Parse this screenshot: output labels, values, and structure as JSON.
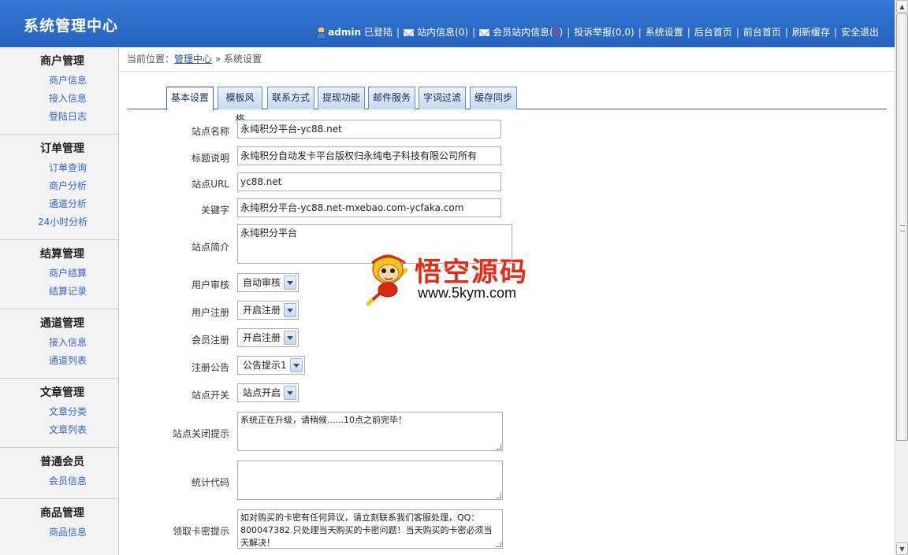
{
  "header": {
    "title": "系统管理中心",
    "user": "admin",
    "logged_in": "已登陆",
    "links": {
      "site_msg": "站内信息",
      "site_msg_count": "(0)",
      "member_msg": "会员站内信息",
      "member_msg_open": "(",
      "member_msg_count": "0",
      "member_msg_close": ")",
      "complaint": "投诉举报(0,0)",
      "settings": "系统设置",
      "admin_home": "后台首页",
      "front_home": "前台首页",
      "refresh_cache": "刷新缓存",
      "logout": "安全退出"
    }
  },
  "sidebar": {
    "groups": [
      {
        "title": "商户管理",
        "items": [
          "商户信息",
          "接入信息",
          "登陆日志"
        ]
      },
      {
        "title": "订单管理",
        "items": [
          "订单查询",
          "商户分析",
          "通道分析",
          "24小时分析"
        ]
      },
      {
        "title": "结算管理",
        "items": [
          "商户结算",
          "结算记录"
        ]
      },
      {
        "title": "通道管理",
        "items": [
          "接入信息",
          "通道列表"
        ]
      },
      {
        "title": "文章管理",
        "items": [
          "文章分类",
          "文章列表"
        ]
      },
      {
        "title": "普通会员",
        "items": [
          "会员信息"
        ]
      },
      {
        "title": "商品管理",
        "items": [
          "商品信息"
        ]
      }
    ]
  },
  "breadcrumb": {
    "prefix": "当前位置：",
    "home": "管理中心",
    "separator": "»",
    "current": "系统设置"
  },
  "tabs": [
    "基本设置",
    "模板风格",
    "联系方式",
    "提现功能",
    "邮件服务",
    "字词过滤",
    "缓存同步"
  ],
  "form": {
    "site_name": {
      "label": "站点名称",
      "value": "永纯积分平台-yc88.net"
    },
    "title_desc": {
      "label": "标题说明",
      "value": "永纯积分自动发卡平台版权归永纯电子科技有限公司所有"
    },
    "site_url": {
      "label": "站点URL",
      "value": "yc88.net"
    },
    "keywords": {
      "label": "关键字",
      "value": "永纯积分平台-yc88.net-mxebao.com-ycfaka.com"
    },
    "site_intro": {
      "label": "站点简介",
      "value": "永纯积分平台"
    },
    "user_review": {
      "label": "用户审核",
      "value": "自动审核"
    },
    "user_register": {
      "label": "用户注册",
      "value": "开启注册"
    },
    "member_register": {
      "label": "会员注册",
      "value": "开启注册"
    },
    "register_notice": {
      "label": "注册公告",
      "value": "公告提示1"
    },
    "site_switch": {
      "label": "站点开关",
      "value": "站点开启"
    },
    "close_tip": {
      "label": "站点关闭提示",
      "value": "系统正在升级，请稍候......10点之前完毕！"
    },
    "stat_code": {
      "label": "统计代码",
      "value": ""
    },
    "card_tip": {
      "label": "领取卡密提示",
      "value": "如对购买的卡密有任何异议，请立刻联系我们客服处理，QQ：800047382 只处理当天购买的卡密问题！当天购买的卡密必须当天解决！"
    }
  },
  "watermark": {
    "cn": "悟空源码",
    "url": "www.5kym.com"
  }
}
